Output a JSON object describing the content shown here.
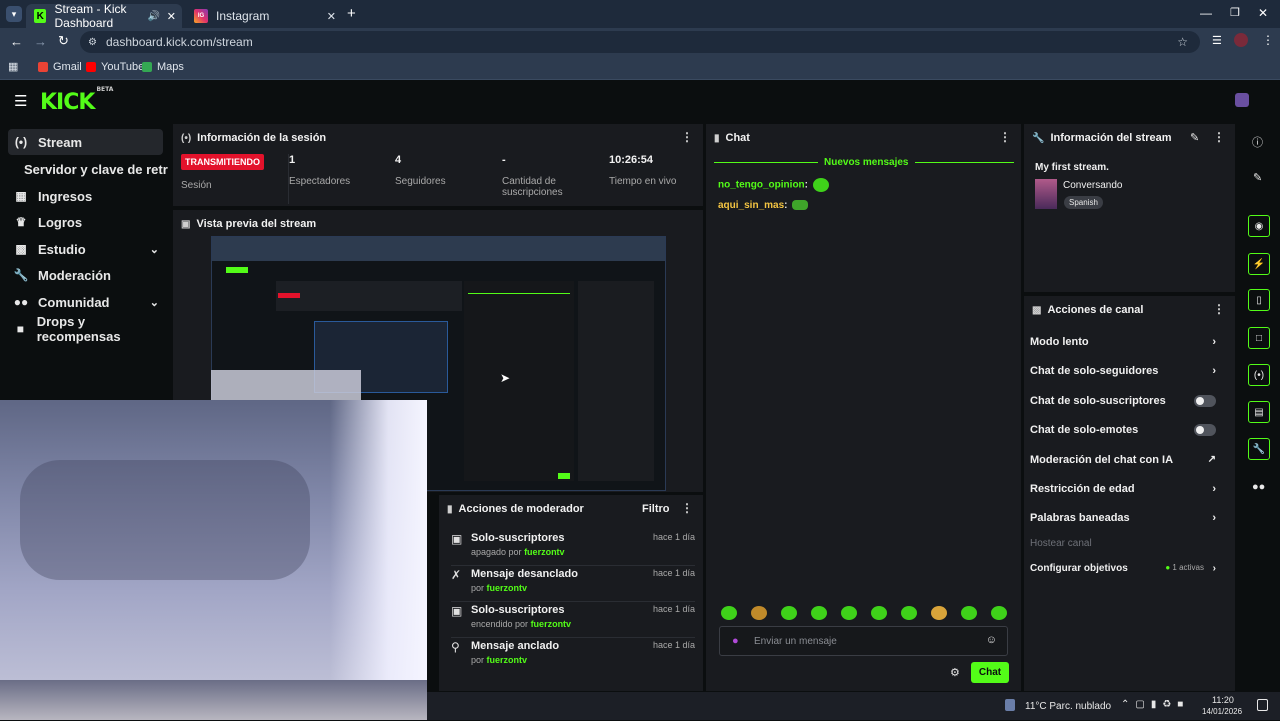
{
  "browser": {
    "tabs": [
      {
        "title": "Stream - Kick Dashboard",
        "favicon": "K"
      },
      {
        "title": "Instagram",
        "favicon": "IG"
      }
    ],
    "url": "dashboard.kick.com/stream",
    "bookmarks": [
      "Gmail",
      "YouTube",
      "Maps"
    ]
  },
  "kick": {
    "logo": "KICK",
    "logo_badge": "BETA"
  },
  "sidebar": {
    "items": [
      {
        "label": "Stream",
        "icon": "broadcast-icon"
      },
      {
        "label": "Servidor y clave de retransmisión",
        "icon": ""
      },
      {
        "label": "Ingresos",
        "icon": "chart-icon"
      },
      {
        "label": "Logros",
        "icon": "trophy-icon"
      },
      {
        "label": "Estudio",
        "icon": "grid-icon"
      },
      {
        "label": "Moderación",
        "icon": "wrench-icon"
      },
      {
        "label": "Comunidad",
        "icon": "people-icon"
      },
      {
        "label": "Drops y recompensas",
        "icon": "gift-icon"
      }
    ]
  },
  "session": {
    "title": "Información de la sesión",
    "live_badge": "TRANSMITIENDO",
    "stats": [
      {
        "value": "",
        "label": "Sesión"
      },
      {
        "value": "1",
        "label": "Espectadores"
      },
      {
        "value": "4",
        "label": "Seguidores"
      },
      {
        "value": "-",
        "label": "Cantidad de suscripciones"
      },
      {
        "value": "10:26:54",
        "label": "Tiempo en vivo"
      }
    ]
  },
  "preview": {
    "title": "Vista previa del stream"
  },
  "chat": {
    "title": "Chat",
    "divider": "Nuevos mensajes",
    "messages": [
      {
        "user": "no_tengo_opinion",
        "color": "#53fc18"
      },
      {
        "user": "aqui_sin_mas",
        "color": "#f5c542"
      }
    ],
    "placeholder": "Enviar un mensaje",
    "send": "Chat"
  },
  "stream_info": {
    "title": "Información del stream",
    "stream_title": "My first stream.",
    "category": "Conversando",
    "language": "Spanish"
  },
  "channel_actions": {
    "title": "Acciones de canal",
    "items": [
      {
        "label": "Modo lento",
        "control": "chevron"
      },
      {
        "label": "Chat de solo-seguidores",
        "control": "chevron"
      },
      {
        "label": "Chat de solo-suscriptores",
        "control": "toggle"
      },
      {
        "label": "Chat de solo-emotes",
        "control": "toggle"
      },
      {
        "label": "Moderación del chat con IA",
        "control": "external"
      },
      {
        "label": "Restricción de edad",
        "control": "chevron"
      },
      {
        "label": "Palabras baneadas",
        "control": "chevron"
      },
      {
        "label": "Hostear canal",
        "control": "none"
      },
      {
        "label": "Configurar objetivos",
        "control": "chevron",
        "extra": "1 activas"
      }
    ]
  },
  "mod_actions": {
    "title": "Acciones de moderador",
    "filter": "Filtro",
    "items": [
      {
        "title": "Solo-suscriptores",
        "sub": "apagado por",
        "user": "fuerzontv",
        "time": "hace 1 día",
        "icon": "gift-icon"
      },
      {
        "title": "Mensaje desanclado",
        "sub": "por",
        "user": "fuerzontv",
        "time": "hace 1 día",
        "icon": "unpin-icon"
      },
      {
        "title": "Solo-suscriptores",
        "sub": "encendido por",
        "user": "fuerzontv",
        "time": "hace 1 día",
        "icon": "gift-icon"
      },
      {
        "title": "Mensaje anclado",
        "sub": "por",
        "user": "fuerzontv",
        "time": "hace 1 día",
        "icon": "pin-icon"
      }
    ]
  },
  "taskbar": {
    "weather": "11°C  Parc. nublado",
    "time": "11:20",
    "date": "14/01/2026"
  }
}
